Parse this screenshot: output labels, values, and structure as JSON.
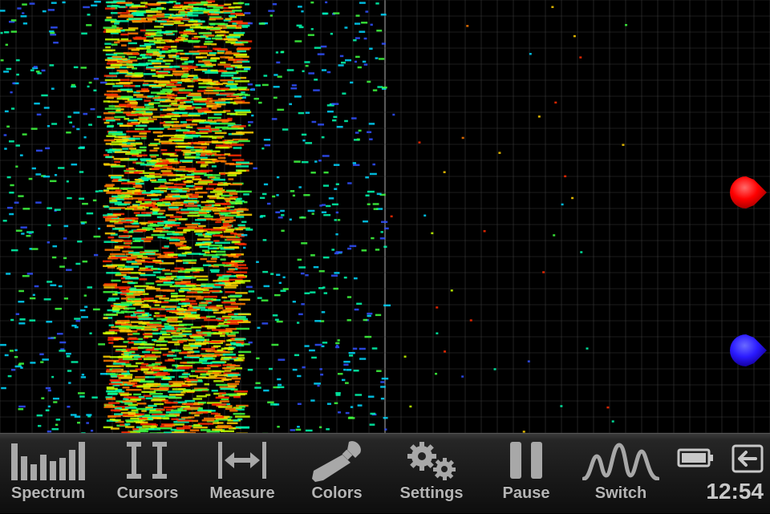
{
  "toolbar": {
    "items": [
      {
        "label": "Spectrum",
        "icon": "spectrum-icon"
      },
      {
        "label": "Cursors",
        "icon": "cursors-icon"
      },
      {
        "label": "Measure",
        "icon": "measure-icon"
      },
      {
        "label": "Colors",
        "icon": "eyedropper-icon"
      },
      {
        "label": "Settings",
        "icon": "gears-icon"
      },
      {
        "label": "Pause",
        "icon": "pause-icon"
      },
      {
        "label": "Switch",
        "icon": "switch-waveform-icon"
      }
    ]
  },
  "status": {
    "time": "12:54",
    "battery_icon": "battery-icon",
    "exit_icon": "exit-icon"
  },
  "cursors": {
    "red_color": "#ff0000",
    "blue_color": "#2a1aff"
  },
  "colors": {
    "background": "#000000",
    "grid": "#3a3a3a",
    "toolbar_text": "#b5b5b5"
  }
}
